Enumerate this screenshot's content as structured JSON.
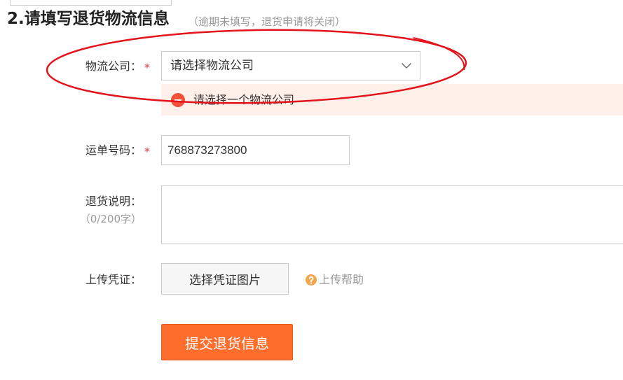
{
  "header": {
    "title": "2.请填写退货物流信息",
    "note": "（逾期未填写，退货申请将关闭）"
  },
  "form": {
    "logistics_company": {
      "label": "物流公司：",
      "required_mark": "*",
      "selected": "请选择物流公司",
      "error_message": "请选择一个物流公司"
    },
    "tracking_number": {
      "label": "运单号码：",
      "required_mark": "*",
      "value": "768873273800"
    },
    "return_description": {
      "label": "退货说明：",
      "char_counter": "（0/200字）"
    },
    "proof_upload": {
      "label": "上传凭证：",
      "button_label": "选择凭证图片",
      "help_link": "上传帮助"
    },
    "submit": {
      "label": "提交退货信息"
    }
  },
  "icons": {
    "select_toggle": "chevron-down-icon",
    "error": "error-icon",
    "help": "help-icon"
  },
  "colors": {
    "accent": "#ff6d2d",
    "accent_border": "#e85c1f",
    "required": "#e4393c",
    "error_bg": "#fff1e9",
    "error_icon": "#f2523a",
    "help_icon": "#f5a64c",
    "annotation": "#e3121b"
  }
}
